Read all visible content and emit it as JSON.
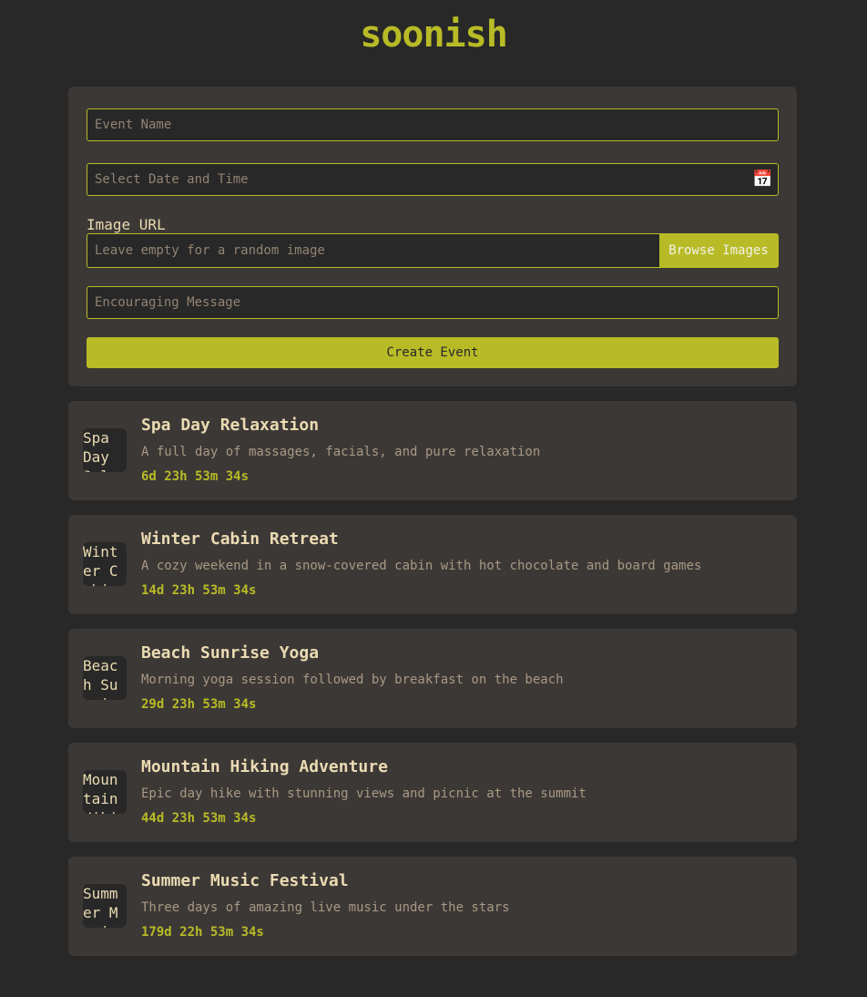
{
  "app": {
    "title": "soonish"
  },
  "form": {
    "event_name_placeholder": "Event Name",
    "datetime_placeholder": "Select Date and Time",
    "image_url_label": "Image URL",
    "image_url_placeholder": "Leave empty for a random image",
    "browse_images_label": "Browse Images",
    "message_placeholder": "Encouraging Message",
    "create_event_label": "Create Event",
    "calendar_icon": "📅"
  },
  "events": [
    {
      "name": "Spa Day Relaxation",
      "description": "A full day of massages, facials, and pure relaxation",
      "countdown": "6d 23h 53m 34s",
      "thumb_alt": "Spa Day Relaxation"
    },
    {
      "name": "Winter Cabin Retreat",
      "description": "A cozy weekend in a snow-covered cabin with hot chocolate and board games",
      "countdown": "14d 23h 53m 34s",
      "thumb_alt": "Winter Cabin Retreat"
    },
    {
      "name": "Beach Sunrise Yoga",
      "description": "Morning yoga session followed by breakfast on the beach",
      "countdown": "29d 23h 53m 34s",
      "thumb_alt": "Beach Sunrise Yoga"
    },
    {
      "name": "Mountain Hiking Adventure",
      "description": "Epic day hike with stunning views and picnic at the summit",
      "countdown": "44d 23h 53m 34s",
      "thumb_alt": "Mountain Hiking Adventure"
    },
    {
      "name": "Summer Music Festival",
      "description": "Three days of amazing live music under the stars",
      "countdown": "179d 22h 53m 34s",
      "thumb_alt": "Summer Music Festival"
    }
  ],
  "colors": {
    "accent": "#b8bb26",
    "background": "#282828",
    "card": "#3c3836",
    "text": "#ebdbb2",
    "muted": "#a89984"
  }
}
